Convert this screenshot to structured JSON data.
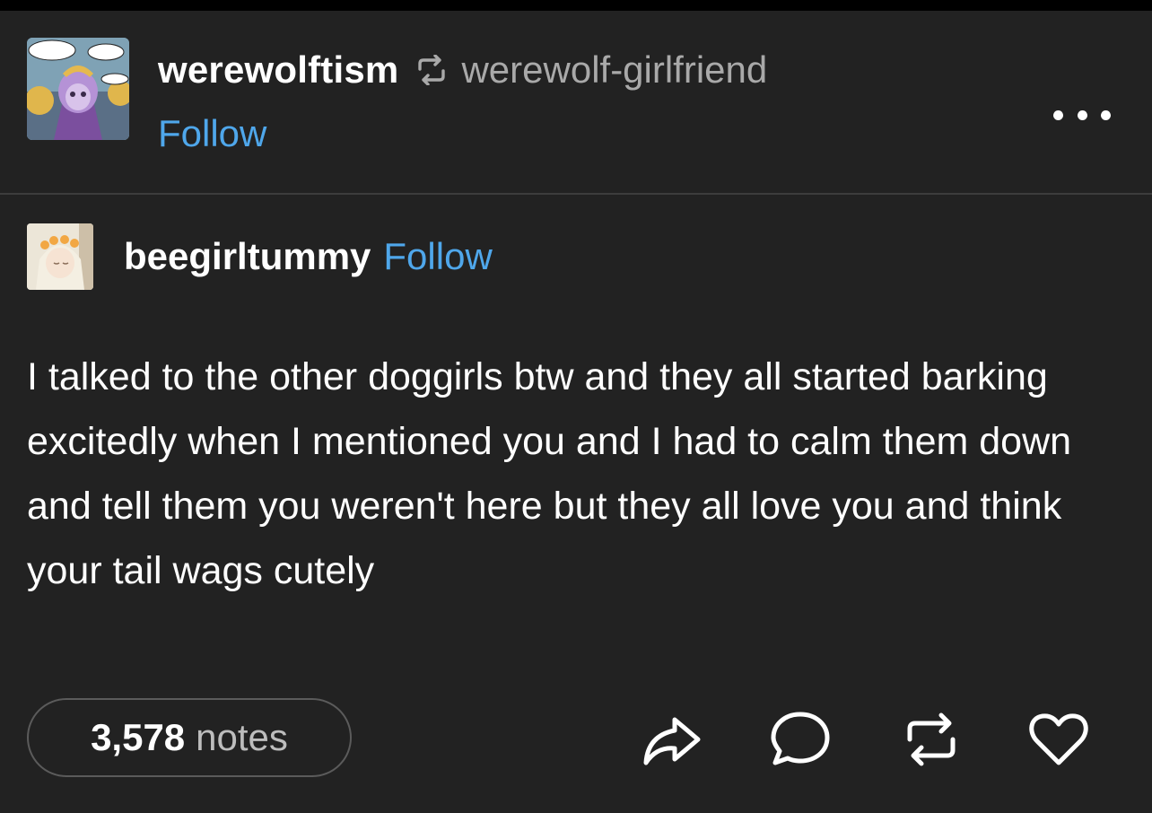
{
  "header": {
    "blog_name": "werewolftism",
    "reblogged_from": "werewolf-girlfriend",
    "follow_label": "Follow",
    "avatar_icon": "comic-avatar",
    "avatar_bubbles": [
      "Can we GET there? You can GET us there, RIGHT?",
      "With SCIENCE?",
      "MAYBE"
    ]
  },
  "post": {
    "author": "beegirltummy",
    "follow_label": "Follow",
    "avatar_icon": "anime-girl-avatar",
    "body": "I talked to the other doggirls btw and they all started barking excitedly when I mentioned you and I had to calm them down and tell them you weren't here but they all love you and think your tail wags cutely"
  },
  "footer": {
    "notes_count": "3,578",
    "notes_label": "notes",
    "actions": [
      "share-icon",
      "comment-icon",
      "reblog-icon",
      "like-icon"
    ]
  },
  "colors": {
    "background": "#222222",
    "accent_link": "#4fa7eb",
    "muted_text": "#a9a9a9"
  }
}
